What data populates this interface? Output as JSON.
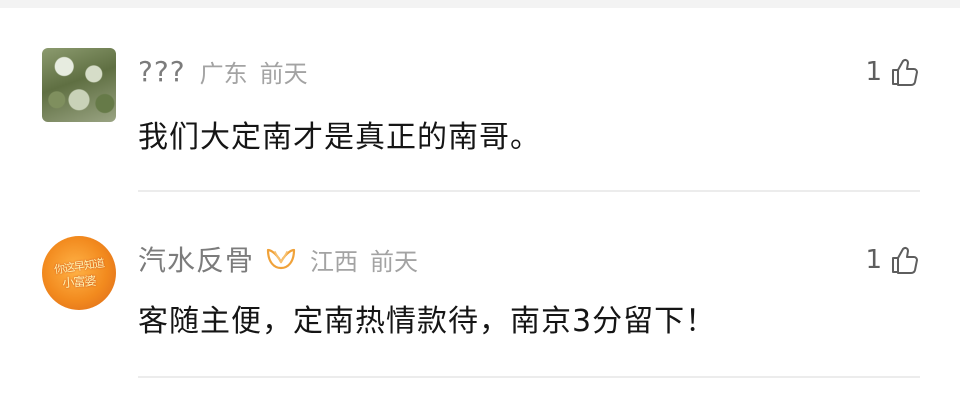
{
  "comments": [
    {
      "username": "???",
      "location": "广东",
      "time": "前天",
      "likes": "1",
      "content": "我们大定南才是真正的南哥。",
      "avatar_icon": "tree-photo-avatar"
    },
    {
      "username": "汽水反骨",
      "badge_icon": "vip-heart-badge-icon",
      "location": "江西",
      "time": "前天",
      "likes": "1",
      "content": "客随主便，定南热情款待，南京3分留下！",
      "avatar_icon": "orange-text-avatar",
      "avatar_text_line1": "你这早知道",
      "avatar_text_line2": "小富婆"
    }
  ],
  "colors": {
    "username": "#7c7c7c",
    "meta": "#a3a3a3",
    "content": "#151515",
    "divider": "#ececec",
    "badge": "#f0a23a"
  }
}
